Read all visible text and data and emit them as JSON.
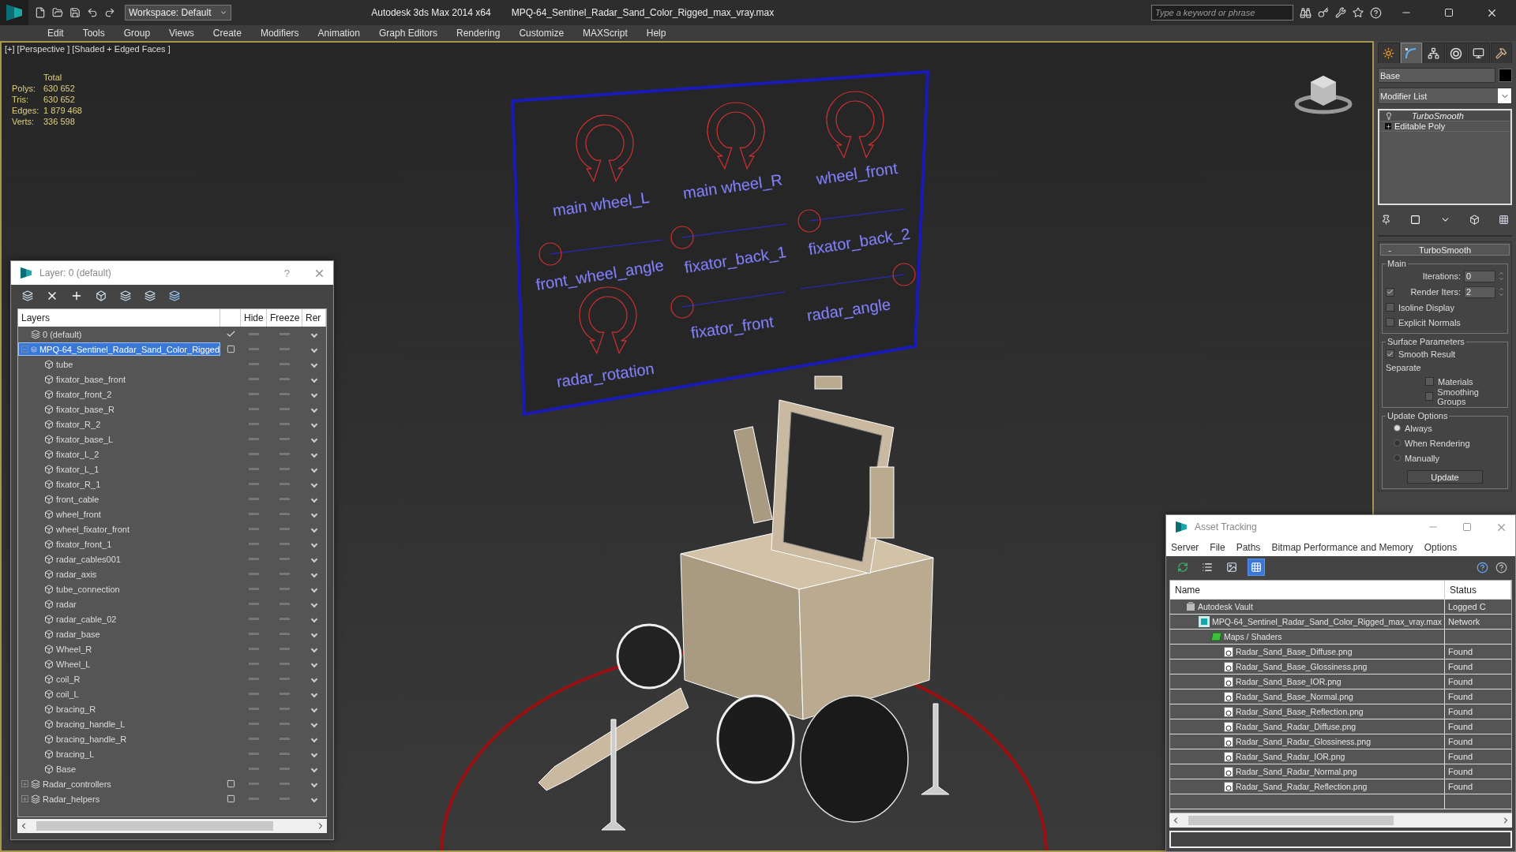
{
  "title_bar": {
    "workspace": "Workspace: Default",
    "app_name": "Autodesk 3ds Max 2014 x64",
    "file_name": "MPQ-64_Sentinel_Radar_Sand_Color_Rigged_max_vray.max",
    "search": {
      "placeholder": "Type a keyword or phrase"
    }
  },
  "menu": [
    "Edit",
    "Tools",
    "Group",
    "Views",
    "Create",
    "Modifiers",
    "Animation",
    "Graph Editors",
    "Rendering",
    "Customize",
    "MAXScript",
    "Help"
  ],
  "viewport": {
    "label": "[+] [Perspective ] [Shaded + Edged Faces ]",
    "stats": {
      "header": "Total",
      "rows": [
        {
          "label": "Polys:",
          "value": "630 652"
        },
        {
          "label": "Tris:",
          "value": "630 652"
        },
        {
          "label": "Edges:",
          "value": "1 879 468"
        },
        {
          "label": "Verts:",
          "value": "336 598"
        }
      ]
    },
    "controls": [
      {
        "label": "main wheel_L",
        "kind": "rotation"
      },
      {
        "label": "main wheel_R",
        "kind": "rotation"
      },
      {
        "label": "wheel_front",
        "kind": "rotation"
      },
      {
        "label": "front_wheel_angle",
        "kind": "slider"
      },
      {
        "label": "fixator_back_1",
        "kind": "slider"
      },
      {
        "label": "fixator_back_2",
        "kind": "slider"
      },
      {
        "label": "radar_rotation",
        "kind": "rotation"
      },
      {
        "label": "fixator_front",
        "kind": "slider"
      },
      {
        "label": "radar_angle",
        "kind": "slider"
      }
    ]
  },
  "layer_window": {
    "title": "Layer: 0 (default)",
    "help": "?",
    "columns": [
      "Layers",
      "Hide",
      "Freeze",
      "Rer"
    ],
    "layers": [
      {
        "name": "0 (default)",
        "kind": "layer",
        "current": true,
        "selected": false
      },
      {
        "name": "MPQ-64_Sentinel_Radar_Sand_Color_Rigged",
        "kind": "layer",
        "current": false,
        "selected": true,
        "expanded": true,
        "children": [
          {
            "name": "tube",
            "kind": "object",
            "selected": false
          },
          {
            "name": "fixator_base_front",
            "kind": "object",
            "selected": false
          },
          {
            "name": "fixator_front_2",
            "kind": "object",
            "selected": false
          },
          {
            "name": "fixator_base_R",
            "kind": "object",
            "selected": false
          },
          {
            "name": "fixator_R_2",
            "kind": "object",
            "selected": false
          },
          {
            "name": "fixator_base_L",
            "kind": "object",
            "selected": false
          },
          {
            "name": "fixator_L_2",
            "kind": "object",
            "selected": false
          },
          {
            "name": "fixator_L_1",
            "kind": "object",
            "selected": false
          },
          {
            "name": "fixator_R_1",
            "kind": "object",
            "selected": false
          },
          {
            "name": "front_cable",
            "kind": "object",
            "selected": false
          },
          {
            "name": "wheel_front",
            "kind": "object",
            "selected": false
          },
          {
            "name": "wheel_fixator_front",
            "kind": "object",
            "selected": false
          },
          {
            "name": "fixator_front_1",
            "kind": "object",
            "selected": false
          },
          {
            "name": "radar_cables001",
            "kind": "object",
            "selected": false
          },
          {
            "name": "radar_axis",
            "kind": "object",
            "selected": false
          },
          {
            "name": "tube_connection",
            "kind": "object",
            "selected": false
          },
          {
            "name": "radar",
            "kind": "object",
            "selected": false
          },
          {
            "name": "radar_cable_02",
            "kind": "object",
            "selected": false
          },
          {
            "name": "radar_base",
            "kind": "object",
            "selected": false
          },
          {
            "name": "Wheel_R",
            "kind": "object",
            "selected": false
          },
          {
            "name": "Wheel_L",
            "kind": "object",
            "selected": false
          },
          {
            "name": "coil_R",
            "kind": "object",
            "selected": false
          },
          {
            "name": "coil_L",
            "kind": "object",
            "selected": false
          },
          {
            "name": "bracing_R",
            "kind": "object",
            "selected": false
          },
          {
            "name": "bracing_handle_L",
            "kind": "object",
            "selected": false
          },
          {
            "name": "bracing_handle_R",
            "kind": "object",
            "selected": false
          },
          {
            "name": "bracing_L",
            "kind": "object",
            "selected": false
          },
          {
            "name": "Base",
            "kind": "object",
            "selected": false
          }
        ]
      },
      {
        "name": "Radar_controllers",
        "kind": "layer",
        "current": false,
        "selected": false,
        "expanded": false
      },
      {
        "name": "Radar_helpers",
        "kind": "layer",
        "current": false,
        "selected": false,
        "expanded": false
      }
    ]
  },
  "command_panel": {
    "tabs": [
      {
        "kind": "create",
        "selected": false
      },
      {
        "kind": "modify",
        "selected": true
      },
      {
        "kind": "hierarchy",
        "selected": false
      },
      {
        "kind": "motion",
        "selected": false
      },
      {
        "kind": "display",
        "selected": false
      },
      {
        "kind": "utilities",
        "selected": false
      }
    ],
    "object_name": "Base",
    "modifier_list": "Modifier List",
    "stack": [
      {
        "label": "TurboSmooth",
        "kind": "modifier"
      },
      {
        "label": "Editable Poly",
        "kind": "base"
      }
    ],
    "rollout": {
      "collapse": "-",
      "title": "TurboSmooth",
      "groups": [
        {
          "title": "Main",
          "items": [
            {
              "kind": "spinner",
              "label": "Iterations:",
              "value": "0"
            },
            {
              "kind": "check_spinner",
              "label": "Render Iters:",
              "value": "2",
              "checked": true
            },
            {
              "kind": "checkbox",
              "label": "Isoline Display",
              "checked": false
            },
            {
              "kind": "checkbox",
              "label": "Explicit Normals",
              "checked": false
            }
          ]
        },
        {
          "title": "Surface Parameters",
          "items": [
            {
              "kind": "checkbox",
              "label": "Smooth Result",
              "checked": true
            },
            {
              "kind": "caption",
              "label": "Separate",
              "children": [
                {
                  "kind": "checkbox",
                  "label": "Materials",
                  "checked": false
                },
                {
                  "kind": "checkbox",
                  "label": "Smoothing Groups",
                  "checked": false
                }
              ]
            }
          ]
        },
        {
          "title": "Update Options",
          "items": [
            {
              "kind": "radio",
              "label": "Always",
              "selected": true
            },
            {
              "kind": "radio",
              "label": "When Rendering",
              "selected": false
            },
            {
              "kind": "radio",
              "label": "Manually",
              "selected": false
            },
            {
              "kind": "button",
              "label": "Update"
            }
          ]
        }
      ]
    }
  },
  "asset_tracking": {
    "title": "Asset Tracking",
    "menu": [
      "Server",
      "File",
      "Paths",
      "Bitmap Performance and Memory",
      "Options"
    ],
    "toolbar": [
      {
        "kind": "refresh",
        "selected": false
      },
      {
        "kind": "list",
        "selected": false
      },
      {
        "kind": "thumbnails",
        "selected": false
      },
      {
        "kind": "table",
        "selected": true
      }
    ],
    "columns": [
      "Name",
      "Status"
    ],
    "rows": [
      {
        "name": "Autodesk Vault",
        "status": "Logged C",
        "kind": "vault",
        "children": [
          {
            "name": "MPQ-64_Sentinel_Radar_Sand_Color_Rigged_max_vray.max",
            "status": "Network",
            "kind": "scene",
            "children": [
              {
                "name": "Maps / Shaders",
                "kind": "folder",
                "children": [
                  {
                    "name": "Radar_Sand_Base_Diffuse.png",
                    "status": "Found",
                    "kind": "bitmap"
                  },
                  {
                    "name": "Radar_Sand_Base_Glossiness.png",
                    "status": "Found",
                    "kind": "bitmap"
                  },
                  {
                    "name": "Radar_Sand_Base_IOR.png",
                    "status": "Found",
                    "kind": "bitmap"
                  },
                  {
                    "name": "Radar_Sand_Base_Normal.png",
                    "status": "Found",
                    "kind": "bitmap"
                  },
                  {
                    "name": "Radar_Sand_Base_Reflection.png",
                    "status": "Found",
                    "kind": "bitmap"
                  },
                  {
                    "name": "Radar_Sand_Radar_Diffuse.png",
                    "status": "Found",
                    "kind": "bitmap"
                  },
                  {
                    "name": "Radar_Sand_Radar_Glossiness.png",
                    "status": "Found",
                    "kind": "bitmap"
                  },
                  {
                    "name": "Radar_Sand_Radar_IOR.png",
                    "status": "Found",
                    "kind": "bitmap"
                  },
                  {
                    "name": "Radar_Sand_Radar_Normal.png",
                    "status": "Found",
                    "kind": "bitmap"
                  },
                  {
                    "name": "Radar_Sand_Radar_Reflection.png",
                    "status": "Found",
                    "kind": "bitmap"
                  }
                ]
              }
            ]
          }
        ]
      }
    ]
  }
}
